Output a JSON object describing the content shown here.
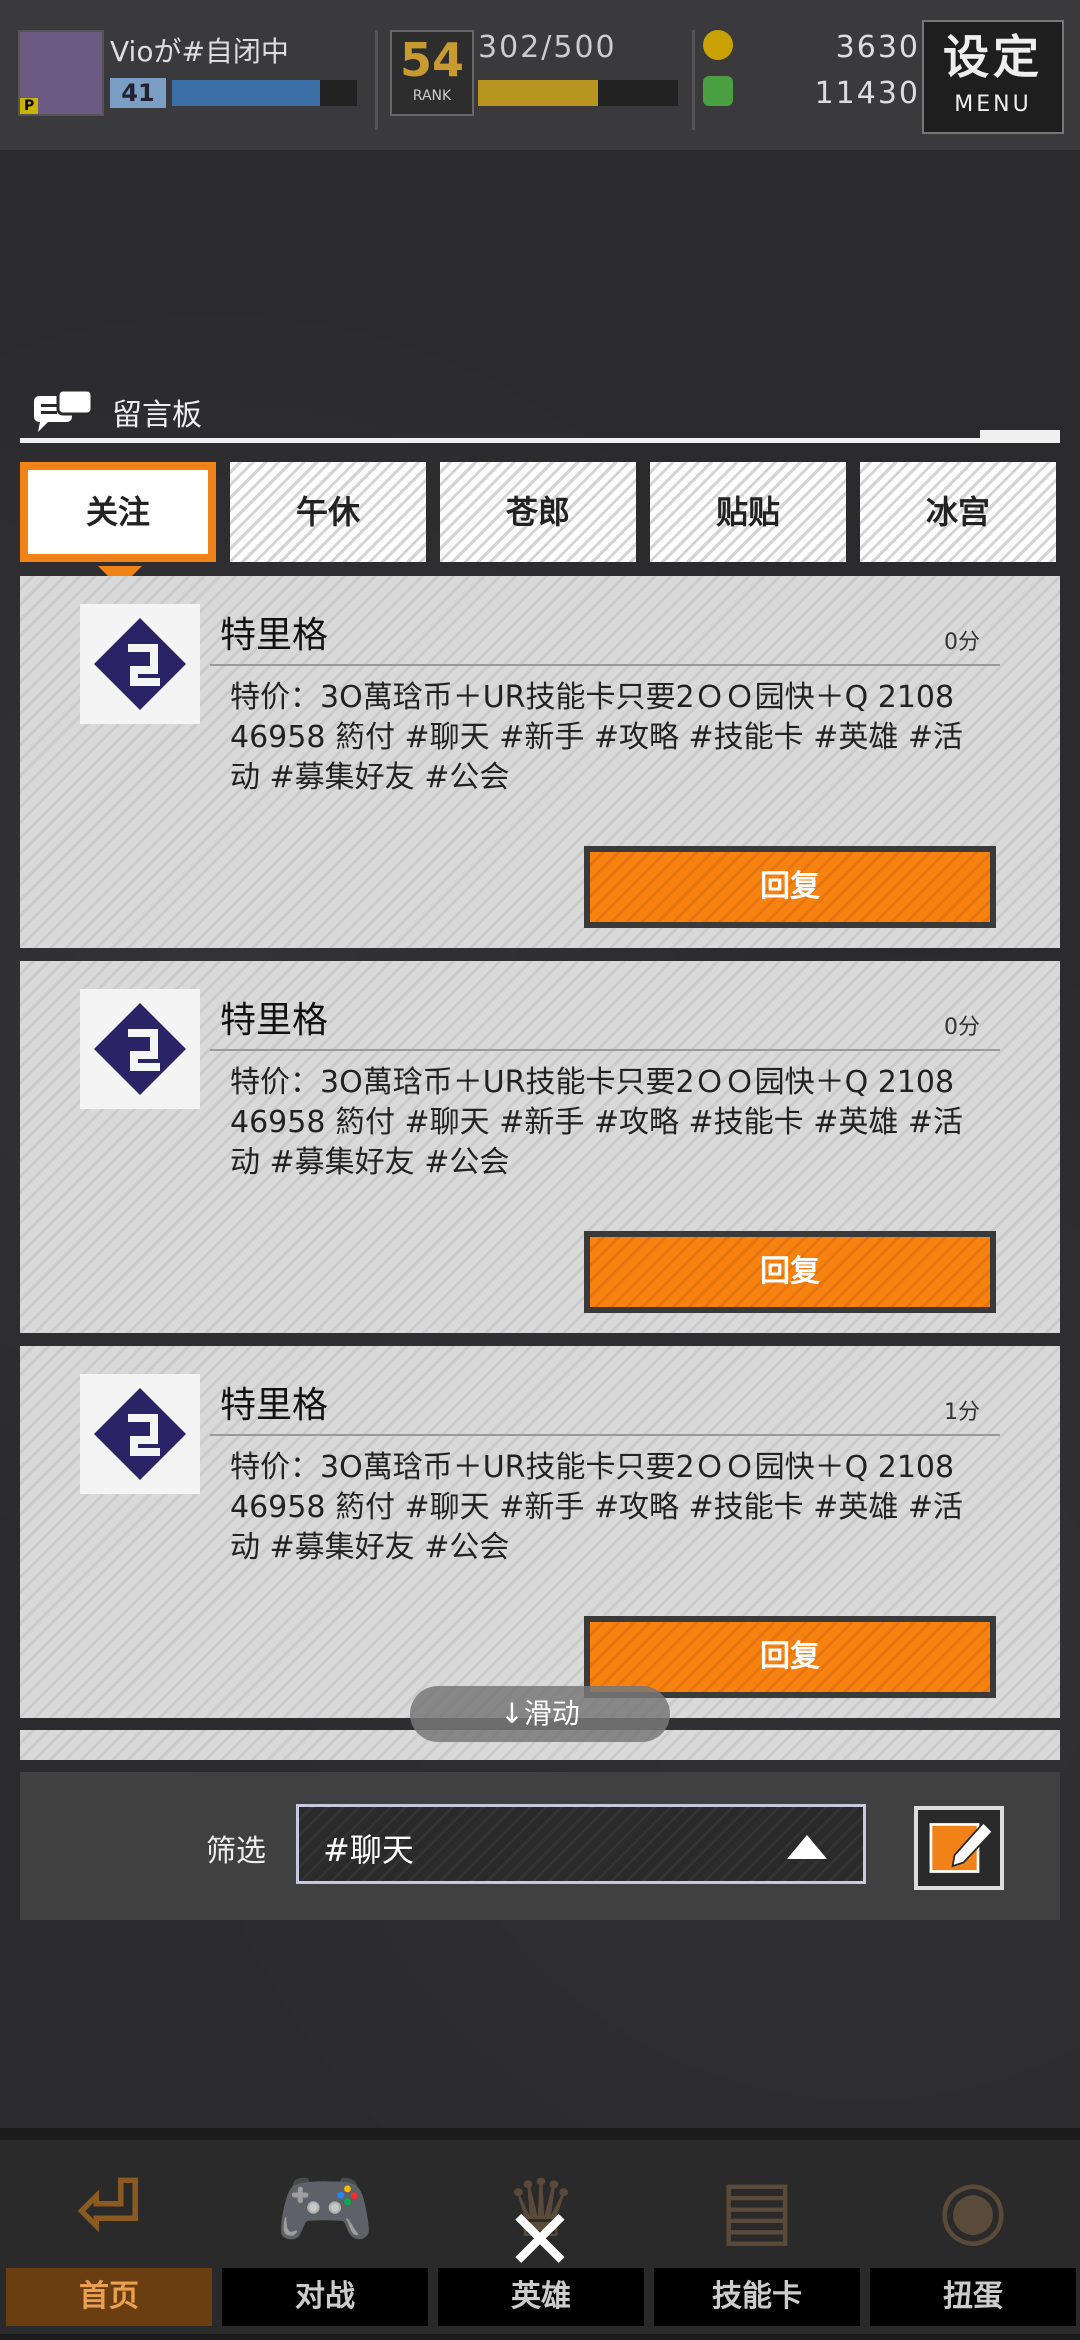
{
  "header": {
    "player_name": "Vioが#自闭中",
    "level": "41",
    "rank": "54",
    "rank_label": "RANK",
    "stamina": "302/500",
    "currency_gold": "3630",
    "currency_green": "11430",
    "settings_label": "设定",
    "settings_sub": "MENU",
    "xp_progress": 0.8,
    "stamina_progress": 0.6
  },
  "board": {
    "title": "留言板"
  },
  "tabs": [
    {
      "label": "关注",
      "active": true
    },
    {
      "label": "午休"
    },
    {
      "label": "苍郎"
    },
    {
      "label": "贴贴"
    },
    {
      "label": "冰宫"
    }
  ],
  "messages": [
    {
      "author": "特里格",
      "time": "0分",
      "body": "特价：3O萬琀币＋UR技能卡只要2ＯＯ园快＋Q 2108 46958 箹付 #聊天 #新手 #攻略 #技能卡 #英雄 #活动 #募集好友 #公会",
      "reply_label": "回复"
    },
    {
      "author": "特里格",
      "time": "0分",
      "body": "特价：3O萬琀币＋UR技能卡只要2ＯＯ园快＋Q 2108 46958 箹付 #聊天 #新手 #攻略 #技能卡 #英雄 #活动 #募集好友 #公会",
      "reply_label": "回复"
    },
    {
      "author": "特里格",
      "time": "1分",
      "body": "特价：3O萬琀币＋UR技能卡只要2ＯＯ园快＋Q 2108 46958 箹付 #聊天 #新手 #攻略 #技能卡 #英雄 #活动 #募集好友 #公会",
      "reply_label": "回复"
    }
  ],
  "scroll_hint": "↓滑动",
  "filter": {
    "label": "筛选",
    "value": "#聊天"
  },
  "bottom_nav": [
    {
      "label": "首页",
      "icon": "home-icon",
      "active": true
    },
    {
      "label": "对战",
      "icon": "gamepad-icon"
    },
    {
      "label": "英雄",
      "icon": "hero-icon"
    },
    {
      "label": "技能卡",
      "icon": "skill-card-icon"
    },
    {
      "label": "扭蛋",
      "icon": "gacha-icon"
    }
  ],
  "icons": {
    "close": "close-icon",
    "compose": "compose-icon",
    "board": "chat-bubble-icon"
  },
  "colors": {
    "accent": "#f08218",
    "panel": "#d9d9d9"
  }
}
